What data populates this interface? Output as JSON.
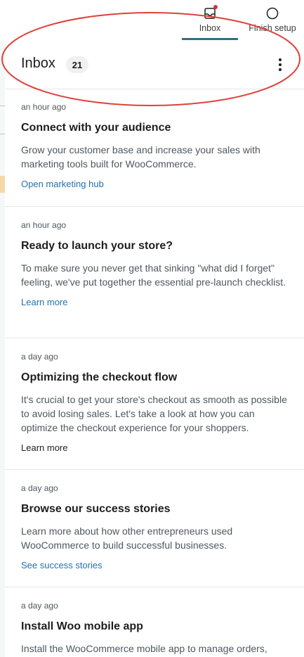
{
  "tabs": [
    {
      "label": "Inbox",
      "icon": "inbox-icon",
      "active": true,
      "has_notification": true
    },
    {
      "label": "Finish setup",
      "icon": "circle-progress-icon",
      "active": false
    }
  ],
  "panel": {
    "title": "Inbox",
    "count": "21"
  },
  "notes": [
    {
      "time": "an hour ago",
      "title": "Connect with your audience",
      "body": "Grow your customer base and increase your sales with marketing tools built for WooCommerce.",
      "action": "Open marketing hub",
      "action_style": "link"
    },
    {
      "time": "an hour ago",
      "title": "Ready to launch your store?",
      "body": "To make sure you never get that sinking \"what did I forget\" feeling, we've put together the essential pre-launch checklist.",
      "action": "Learn more",
      "action_style": "link"
    },
    {
      "time": "a day ago",
      "title": "Optimizing the checkout flow",
      "body": "It's crucial to get your store's checkout as smooth as possible to avoid losing sales. Let's take a look at how you can optimize the checkout experience for your shoppers.",
      "action": "Learn more",
      "action_style": "plain"
    },
    {
      "time": "a day ago",
      "title": "Browse our success stories",
      "body": "Learn more about how other entrepreneurs used WooCommerce to build successful businesses.",
      "action": "See success stories",
      "action_style": "link"
    },
    {
      "time": "a day ago",
      "title": "Install Woo mobile app",
      "body": "Install the WooCommerce mobile app to manage orders,",
      "action": "",
      "action_style": "link"
    }
  ],
  "colors": {
    "link": "#2271b1",
    "active_tab_underline": "#2f6f8a",
    "notification_dot": "#d63638",
    "annotation_ellipse": "#e0403a"
  }
}
